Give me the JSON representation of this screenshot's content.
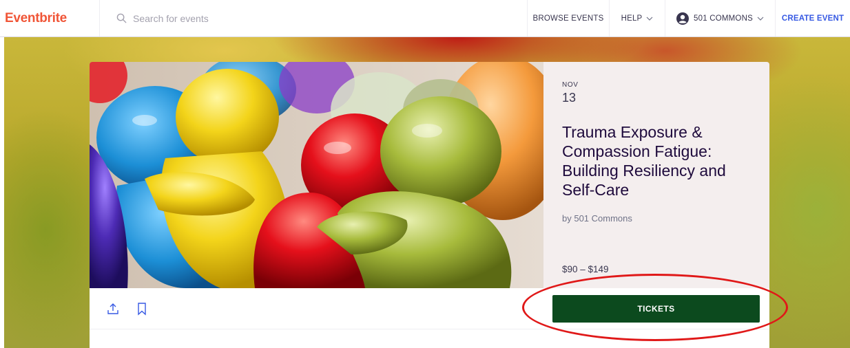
{
  "header": {
    "logo": "Eventbrite",
    "search_placeholder": "Search for events",
    "browse_events": "BROWSE EVENTS",
    "help": "HELP",
    "account": "501 COMMONS",
    "create_event": "CREATE EVENT"
  },
  "event": {
    "month": "NOV",
    "day": "13",
    "title": "Trauma Exposure & Compassion Fatigue: Building Resiliency and Self-Care",
    "organizer": "by 501 Commons",
    "price": "$90 – $149",
    "tickets_label": "TICKETS"
  },
  "icons": {
    "search": "search-icon",
    "help_chevron": "chevron-down-icon",
    "account_avatar": "user-avatar-icon",
    "account_chevron": "chevron-down-icon",
    "share": "share-icon",
    "bookmark": "bookmark-icon"
  },
  "colors": {
    "brand": "#f05537",
    "link_blue": "#3659e3",
    "tickets_button": "#0c4a1e",
    "annotation_circle": "#e01818"
  }
}
